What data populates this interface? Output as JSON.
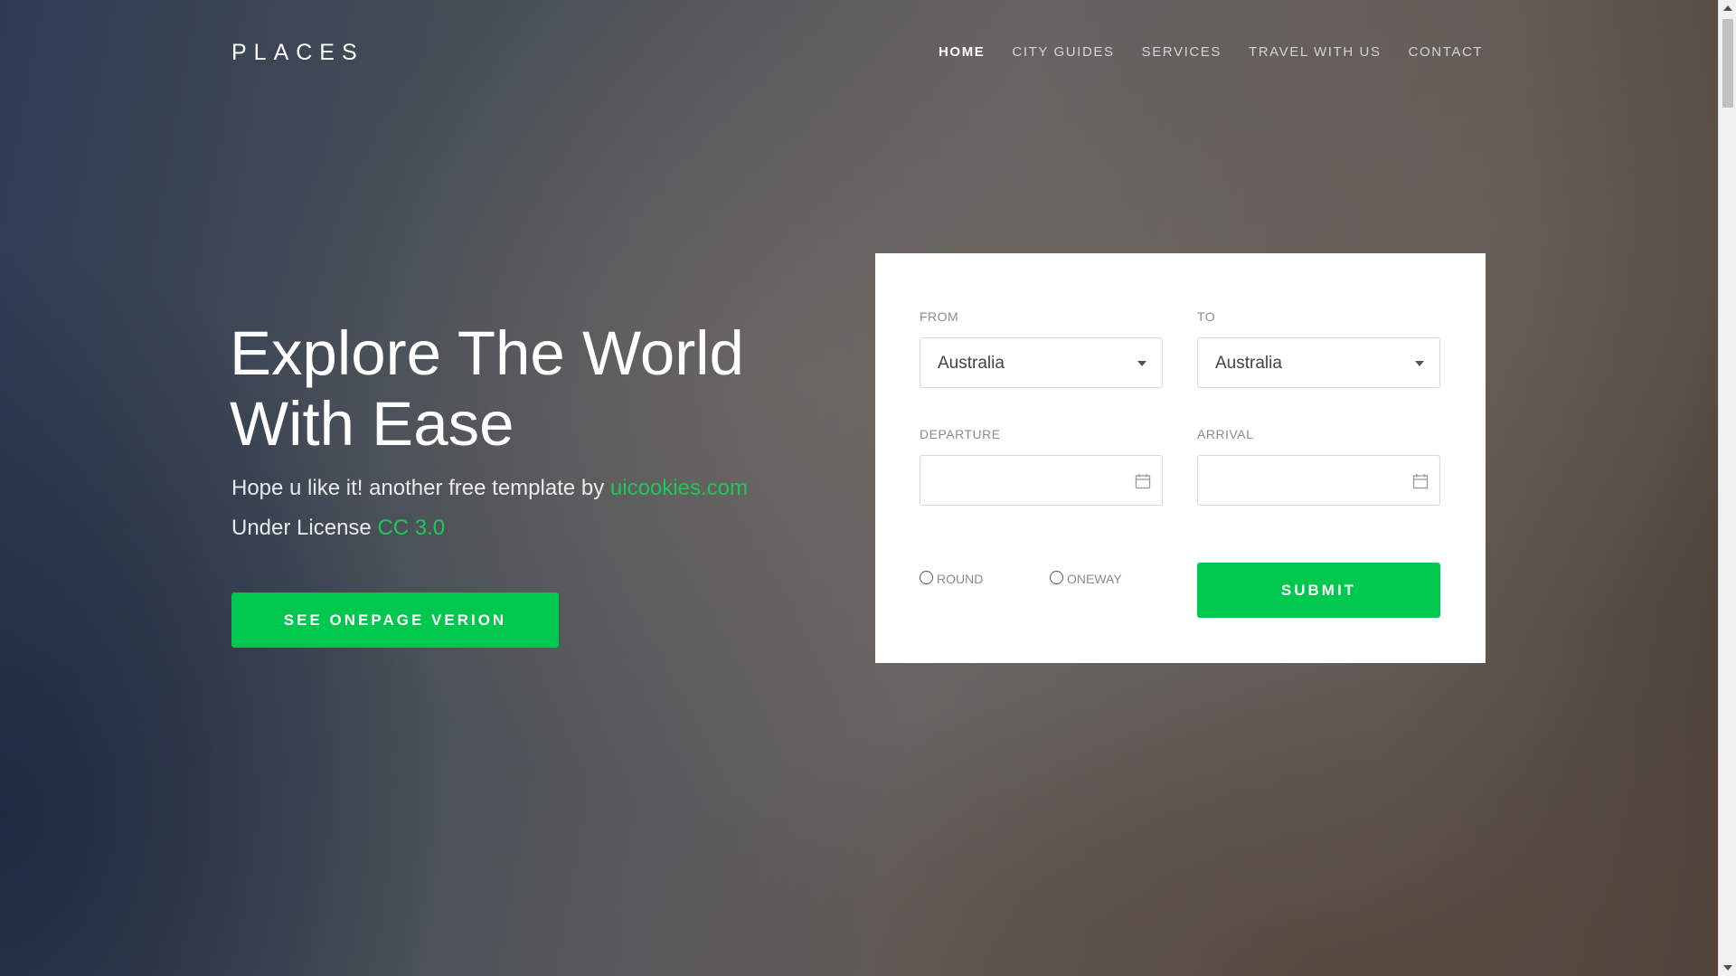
{
  "header": {
    "logo": "PLACES",
    "nav": [
      {
        "label": "HOME",
        "active": true
      },
      {
        "label": "CITY GUIDES",
        "active": false
      },
      {
        "label": "SERVICES",
        "active": false
      },
      {
        "label": "TRAVEL WITH US",
        "active": false
      },
      {
        "label": "CONTACT",
        "active": false
      }
    ]
  },
  "hero": {
    "headline_line1": "Explore The World",
    "headline_line2": "With Ease",
    "subtitle_text": "Hope u like it! another free template by ",
    "subtitle_link": "uicookies.com",
    "license_text": "Under License ",
    "license_link": "CC 3.0",
    "cta_label": "SEE ONEPAGE VERION"
  },
  "booking_form": {
    "from_label": "FROM",
    "from_value": "Australia",
    "to_label": "TO",
    "to_value": "Australia",
    "departure_label": "DEPARTURE",
    "departure_value": "",
    "arrival_label": "ARRIVAL",
    "arrival_value": "",
    "trip_options": [
      "ROUND",
      "ONEWAY"
    ],
    "submit_label": "SUBMIT"
  },
  "colors": {
    "accent": "#00c84f",
    "link": "#1fc75a",
    "card_bg": "#ffffff"
  },
  "icons": {
    "select_caret": "caret-down-icon",
    "date_picker": "calendar-icon"
  }
}
